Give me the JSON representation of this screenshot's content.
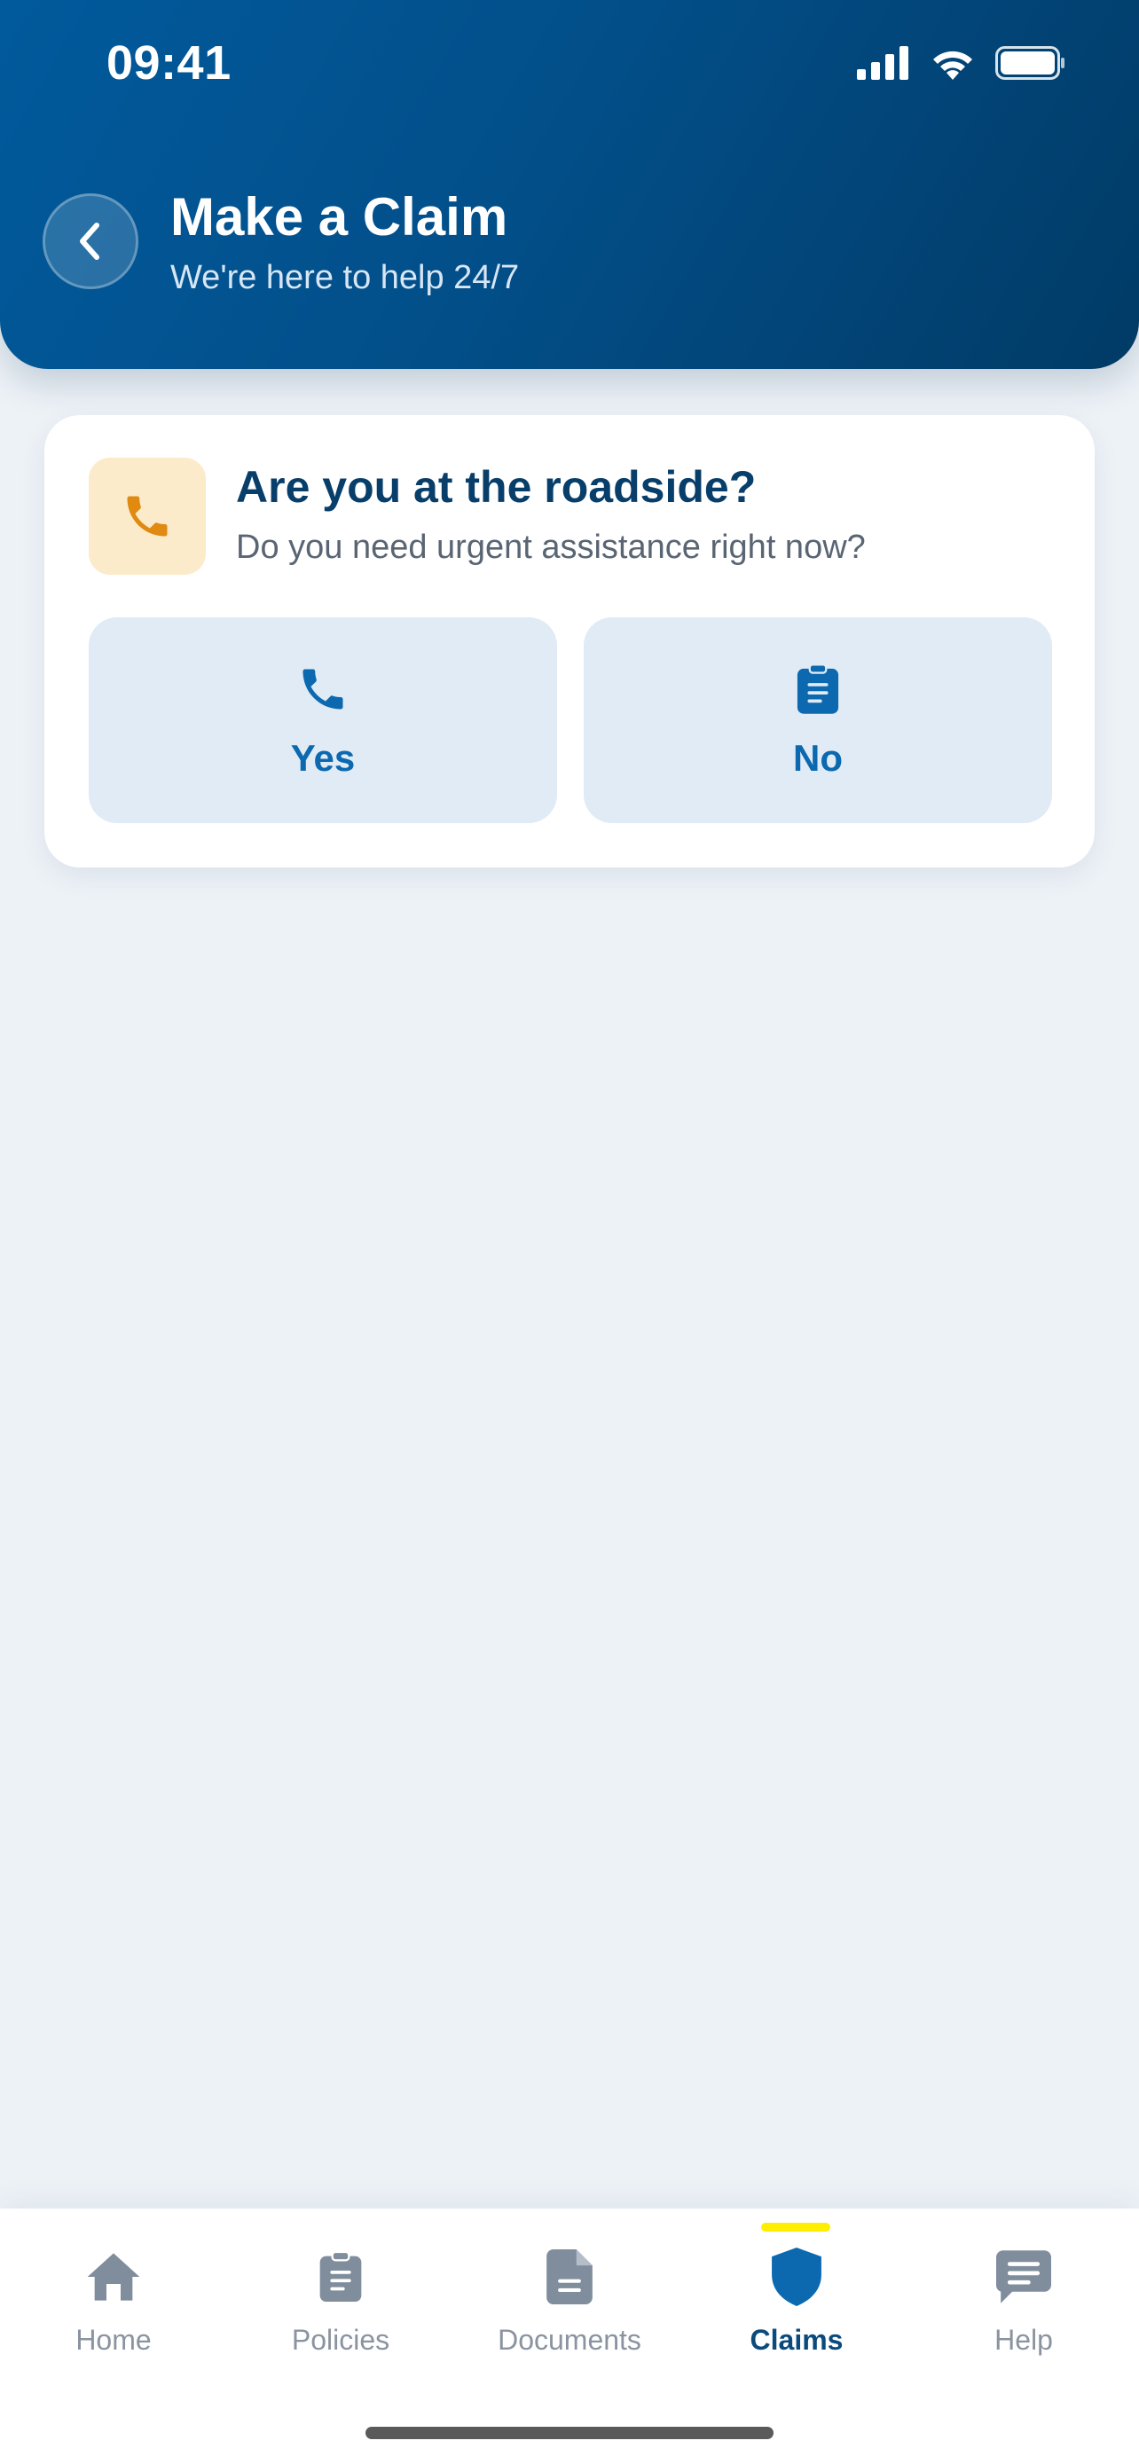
{
  "status_bar": {
    "time": "09:41"
  },
  "header": {
    "title": "Make a Claim",
    "subtitle": "We're here to help 24/7"
  },
  "roadside_card": {
    "icon": "phone-icon",
    "title": "Are you at the roadside?",
    "subtitle": "Do you need urgent assistance right now?",
    "options": [
      {
        "label": "Yes",
        "icon": "phone-icon"
      },
      {
        "label": "No",
        "icon": "clipboard-icon"
      }
    ]
  },
  "tabbar": {
    "active": "Claims",
    "items": [
      {
        "label": "Home",
        "icon": "home-icon"
      },
      {
        "label": "Policies",
        "icon": "clipboard-icon"
      },
      {
        "label": "Documents",
        "icon": "document-icon"
      },
      {
        "label": "Claims",
        "icon": "shield-icon"
      },
      {
        "label": "Help",
        "icon": "chat-icon"
      }
    ]
  },
  "colors": {
    "header_start": "#015a9c",
    "header_end": "#013b66",
    "accent": "#0c69b0",
    "title": "#083e6a",
    "phone_orange": "#e08a12",
    "option_bg": "#e0ebf6",
    "tab_active_indicator": "#ffee00"
  }
}
